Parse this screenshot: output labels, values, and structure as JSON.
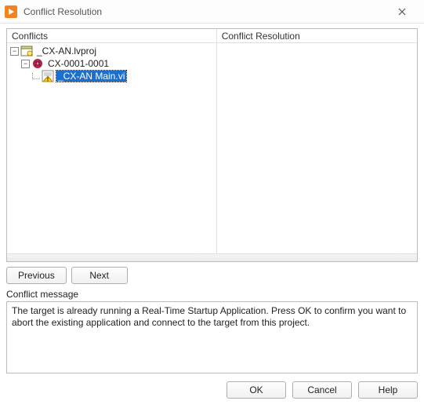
{
  "window": {
    "title": "Conflict Resolution"
  },
  "panes": {
    "left_header": "Conflicts",
    "right_header": "Conflict Resolution"
  },
  "tree": {
    "root": {
      "label": "_CX-AN.lvproj",
      "icon": "project-icon"
    },
    "target": {
      "label": "CX-0001-0001",
      "icon": "target-icon"
    },
    "item": {
      "label": "_CX-AN Main.vi",
      "icon": "vi-warning-icon",
      "selected": true
    }
  },
  "nav": {
    "previous": "Previous",
    "next": "Next"
  },
  "message": {
    "label": "Conflict message",
    "text": "The target is already running a Real-Time Startup Application.  Press OK to confirm you want to abort the existing application and connect to the target from this project."
  },
  "buttons": {
    "ok": "OK",
    "cancel": "Cancel",
    "help": "Help"
  }
}
